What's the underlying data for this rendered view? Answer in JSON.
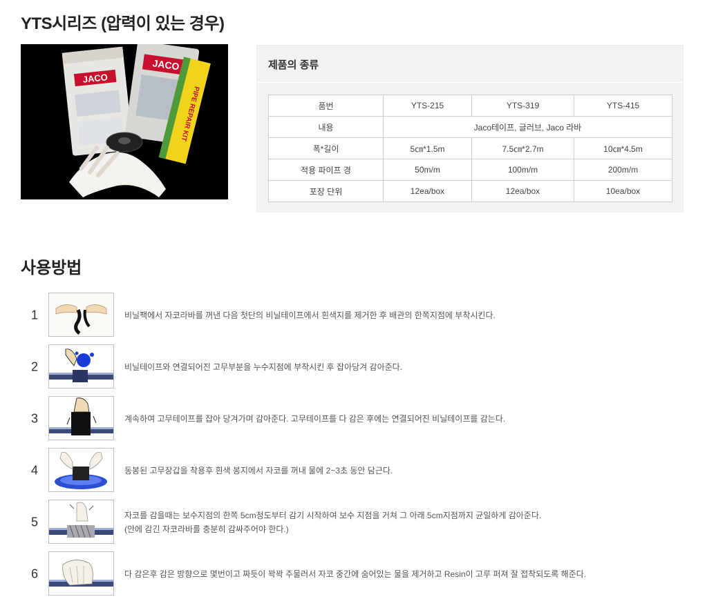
{
  "header": {
    "title": "YTS시리즈 (압력이 있는 경우)"
  },
  "spec": {
    "heading": "제품의 종류",
    "rows": [
      [
        "품번",
        "YTS-215",
        "YTS-319",
        "YTS-415"
      ],
      [
        "내용",
        "Jaco테이프, 글러브, Jaco 라바"
      ],
      [
        "폭*길이",
        "5㎝*1.5m",
        "7.5㎝*2.7m",
        "10㎝*4.5m"
      ],
      [
        "적용 파이프 경",
        "50m/m",
        "100m/m",
        "200m/m"
      ],
      [
        "포장 단위",
        "12ea/box",
        "12ea/box",
        "10ea/box"
      ]
    ]
  },
  "photo": {
    "label1": "JACO",
    "label2": "JACO",
    "label3": "PIPE REPAIR KIT"
  },
  "usage": {
    "title": "사용방법",
    "steps": [
      {
        "num": "1",
        "lines": [
          "비닐팩에서 자코라바를 꺼낸 다음 첫단의 비닐테이프에서 흰색지를 제거한 후 배관의 한쪽지점에 부착시킨다."
        ]
      },
      {
        "num": "2",
        "lines": [
          "비닐테이프와 연결되어진 고무부분을 누수지점에 부착시킨 후 잡아당겨 감아준다."
        ]
      },
      {
        "num": "3",
        "lines": [
          "계속하여 고무테이프를 잡아 당겨가며 감아준다. 고무테이프를 다 감은 후에는 연결되어진 비닐테이프를 감는다."
        ]
      },
      {
        "num": "4",
        "lines": [
          "동봉된 고무장갑을 착용후 흰색 봉지에서 자코를 꺼내 물에 2~3초 동안 담근다."
        ]
      },
      {
        "num": "5",
        "lines": [
          "자코를 감을때는 보수지점의 한쪽 5cm정도부터 감기 시작하여 보수 지점을 거쳐 그 아래 5cm지점까지 균일하게 감아준다.",
          "(안에 감긴 자코라바를 충분히 감싸주어야 한다.)"
        ]
      },
      {
        "num": "6",
        "lines": [
          "다 감은후 감은 방향으로 몇번이고 짜듯이 꽉꽉 주물러서 자코 중간에 숨어있는 물을 제거하고 Resin이 고루 퍼져 잘 접착되도록 해준다."
        ]
      }
    ]
  }
}
